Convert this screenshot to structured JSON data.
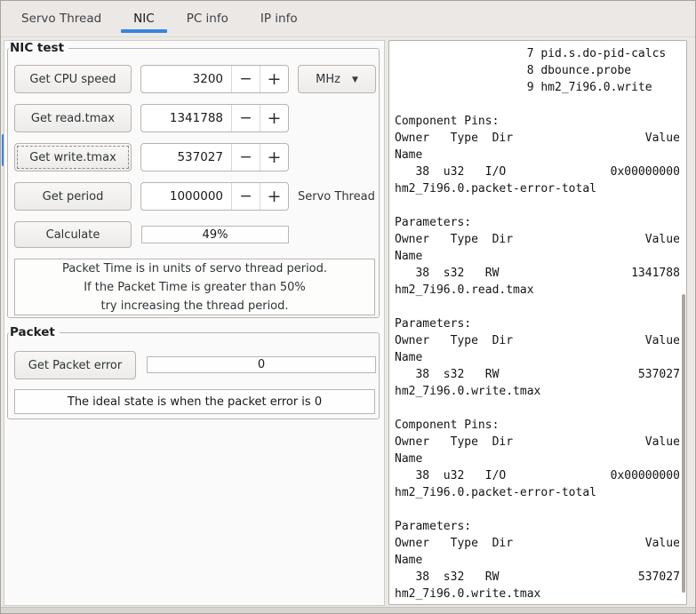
{
  "tabs": [
    {
      "label": "Servo Thread"
    },
    {
      "label": "NIC"
    },
    {
      "label": "PC info"
    },
    {
      "label": "IP info"
    }
  ],
  "nic_test": {
    "title": "NIC test",
    "rows": [
      {
        "button": "Get CPU speed",
        "value": "3200",
        "unit": "MHz"
      },
      {
        "button": "Get read.tmax",
        "value": "1341788"
      },
      {
        "button": "Get write.tmax",
        "value": "537027"
      },
      {
        "button": "Get period",
        "value": "1000000",
        "label": "Servo Thread"
      }
    ],
    "calculate_button": "Calculate",
    "progress_text": "49%",
    "info_lines": [
      "Packet Time is in units of servo thread period.",
      "If the Packet Time is greater than 50%",
      "try increasing the thread period."
    ]
  },
  "packet": {
    "title": "Packet",
    "button": "Get Packet error",
    "value": "0",
    "info": "The ideal state is when the packet error is 0"
  },
  "output": {
    "text": "                   7 pid.s.do-pid-calcs\n                   8 dbounce.probe\n                   9 hm2_7i96.0.write\n\nComponent Pins:\nOwner   Type  Dir                   Value\nName\n   38  u32   I/O               0x00000000\nhm2_7i96.0.packet-error-total\n\nParameters:\nOwner   Type  Dir                   Value\nName\n   38  s32   RW                   1341788\nhm2_7i96.0.read.tmax\n\nParameters:\nOwner   Type  Dir                   Value\nName\n   38  s32   RW                    537027\nhm2_7i96.0.write.tmax\n\nComponent Pins:\nOwner   Type  Dir                   Value\nName\n   38  u32   I/O               0x00000000\nhm2_7i96.0.packet-error-total\n\nParameters:\nOwner   Type  Dir                   Value\nName\n   38  s32   RW                    537027\nhm2_7i96.0.write.tmax"
  },
  "icons": {
    "minus": "−",
    "plus": "+",
    "dropdown_arrow": "▼"
  },
  "colors": {
    "accent": "#3584e4"
  }
}
